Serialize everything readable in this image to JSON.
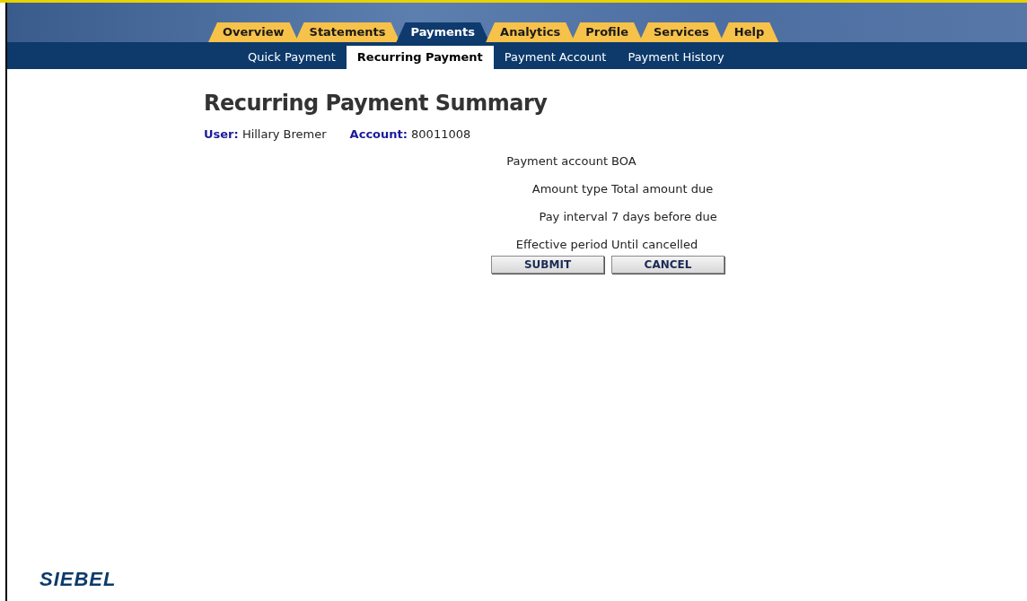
{
  "main_tabs": [
    {
      "label": "Overview",
      "selected": false
    },
    {
      "label": "Statements",
      "selected": false
    },
    {
      "label": "Payments",
      "selected": true
    },
    {
      "label": "Analytics",
      "selected": false
    },
    {
      "label": "Profile",
      "selected": false
    },
    {
      "label": "Services",
      "selected": false
    },
    {
      "label": "Help",
      "selected": false
    }
  ],
  "sub_tabs": [
    {
      "label": "Quick Payment",
      "selected": false
    },
    {
      "label": "Recurring Payment",
      "selected": true
    },
    {
      "label": "Payment Account",
      "selected": false
    },
    {
      "label": "Payment History",
      "selected": false
    }
  ],
  "title": "Recurring Payment Summary",
  "user": {
    "label": "User:",
    "value": "Hillary Bremer"
  },
  "account": {
    "label": "Account:",
    "value": "80011008"
  },
  "fields": [
    {
      "label": "Payment account",
      "value": "BOA"
    },
    {
      "label": "Amount type",
      "value": "Total amount due"
    },
    {
      "label": "Pay interval",
      "value": "7 days before due"
    },
    {
      "label": "Effective period",
      "value": "Until cancelled"
    }
  ],
  "buttons": [
    "SUBMIT",
    "CANCEL"
  ],
  "logo": "SIEBEL"
}
